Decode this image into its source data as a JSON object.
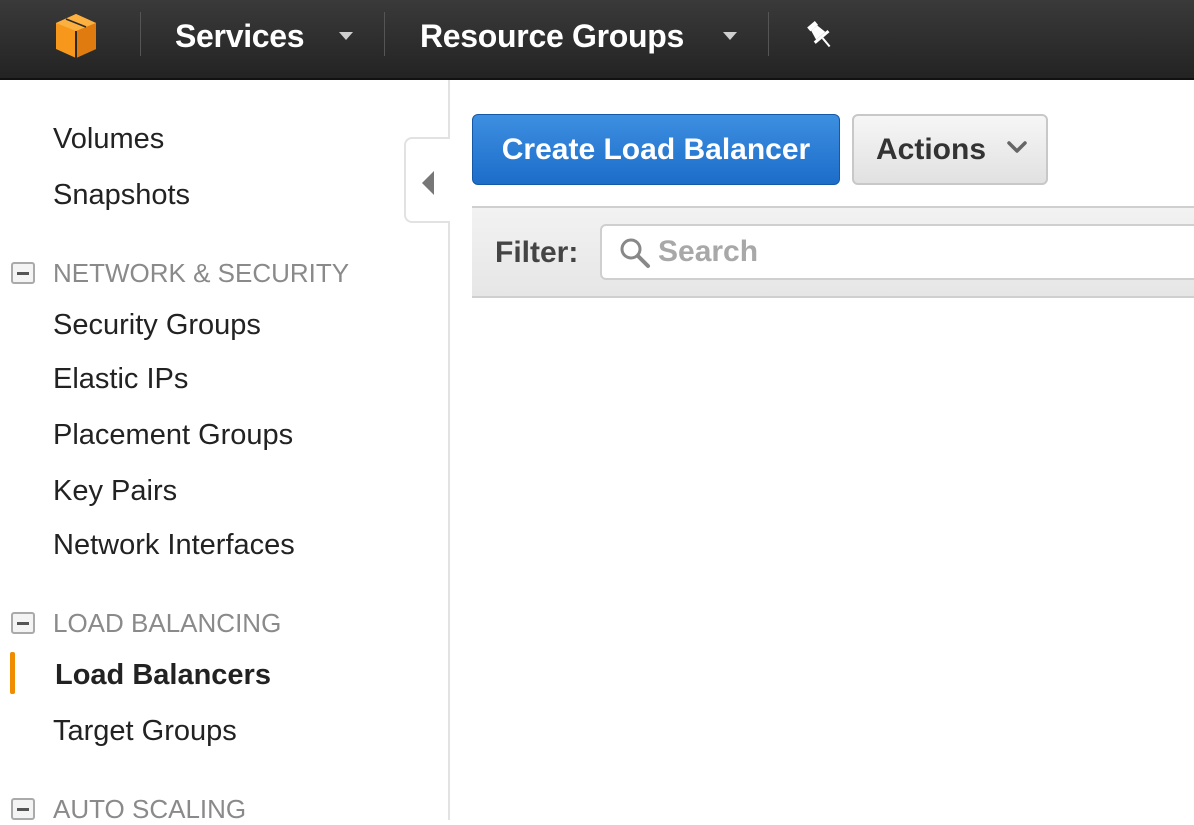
{
  "topbar": {
    "logo_icon": "aws-cube-icon",
    "services_label": "Services",
    "resource_groups_label": "Resource Groups",
    "pin_icon": "pushpin-icon",
    "brand_color": "#f7981d"
  },
  "sidebar": {
    "top_items": [
      "Volumes",
      "Snapshots"
    ],
    "network_security": {
      "heading": "NETWORK & SECURITY",
      "items": [
        "Security Groups",
        "Elastic IPs",
        "Placement Groups",
        "Key Pairs",
        "Network Interfaces"
      ]
    },
    "load_balancing": {
      "heading": "LOAD BALANCING",
      "items": [
        "Load Balancers",
        "Target Groups"
      ],
      "active_item": "Load Balancers"
    },
    "auto_scaling": {
      "heading": "AUTO SCALING"
    },
    "active_color": "#f08c00"
  },
  "toolbar": {
    "create_label": "Create Load Balancer",
    "actions_label": "Actions"
  },
  "filter": {
    "label": "Filter:",
    "search_placeholder": "Search",
    "search_value": ""
  }
}
